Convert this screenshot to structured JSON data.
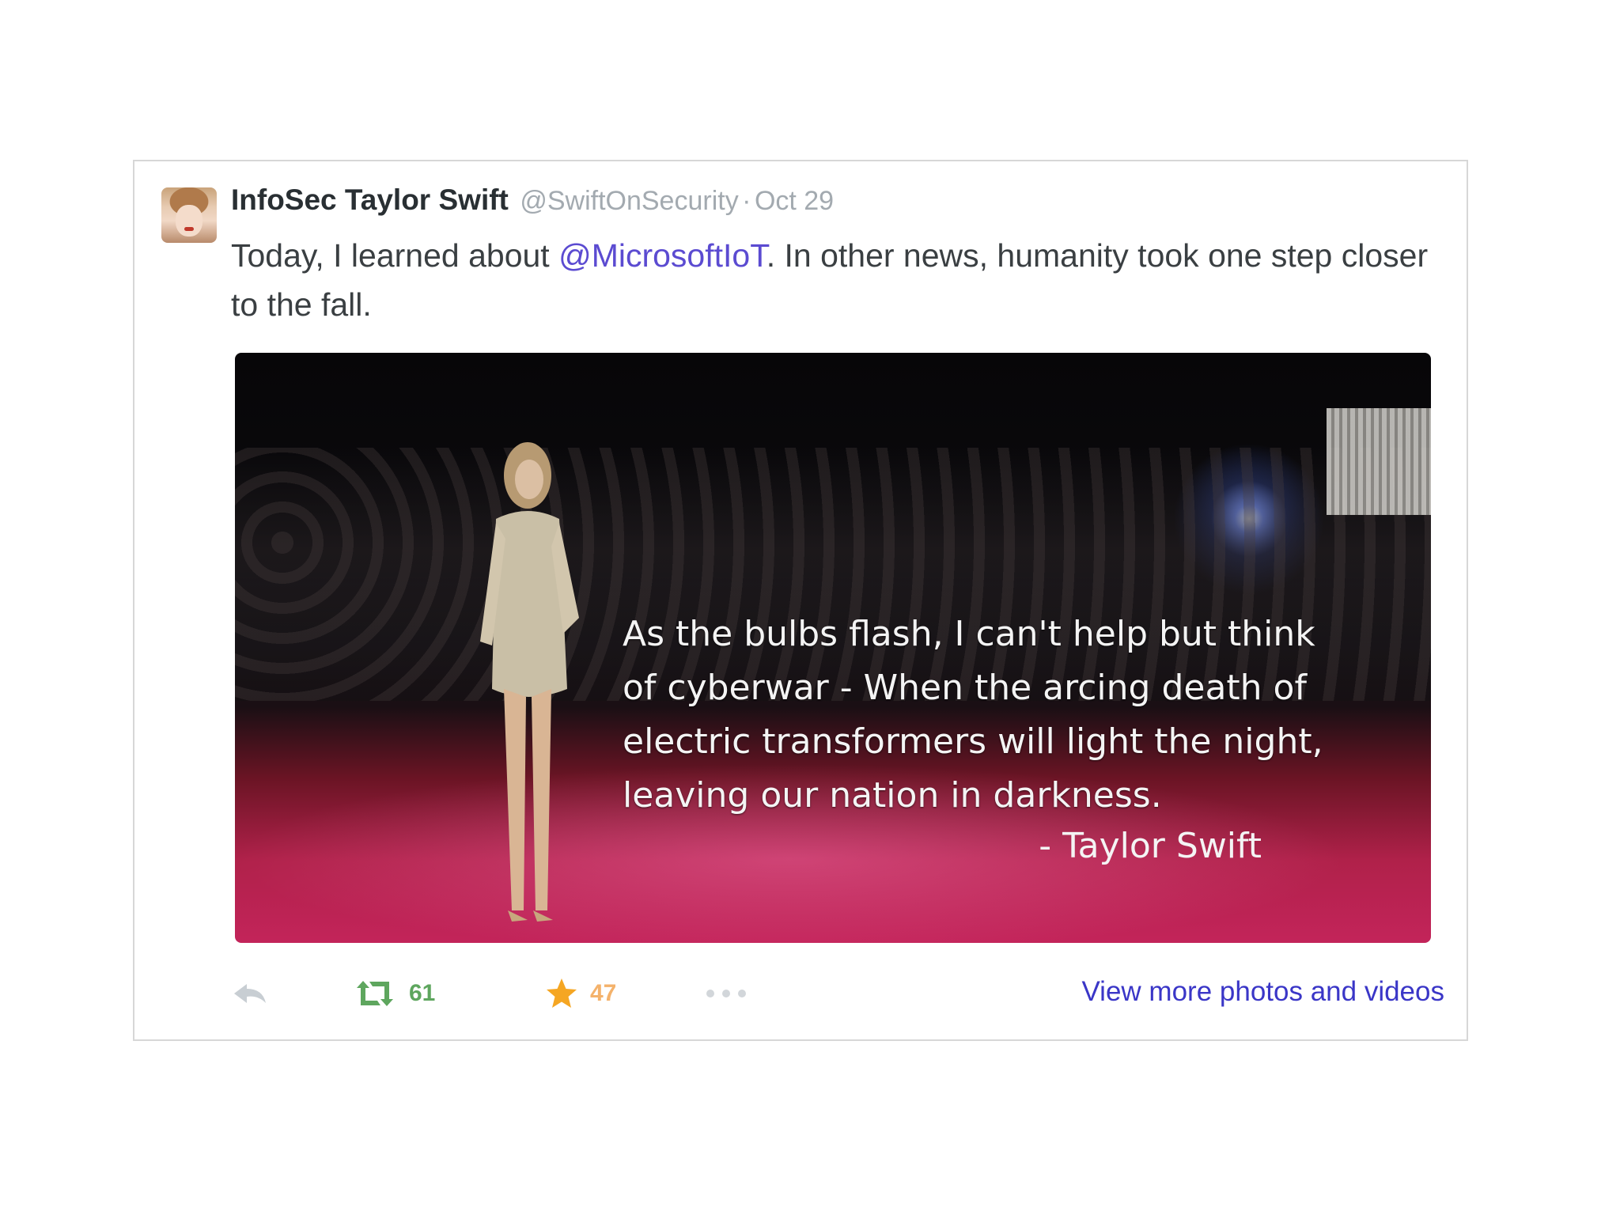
{
  "tweet": {
    "display_name": "InfoSec Taylor Swift",
    "handle": "@SwiftOnSecurity",
    "separator": "·",
    "date": "Oct 29",
    "text_before": "Today, I learned about ",
    "mention": "@MicrosoftIoT",
    "text_after": ". In other news, humanity took one step closer to the fall."
  },
  "photo": {
    "quote": "As the bulbs flash, I can't help but think of cyberwar - When the arcing death of electric transformers will light the night, leaving our nation in darkness.",
    "author": "- Taylor Swift"
  },
  "actions": {
    "retweet_count": "61",
    "favorite_count": "47",
    "view_more": "View more photos and videos"
  },
  "colors": {
    "mention": "#5b4bd1",
    "retweet": "#5ea65e",
    "favorite": "#f4b26b",
    "link": "#3a36c7"
  },
  "icons": [
    "reply-icon",
    "retweet-icon",
    "star-icon",
    "more-icon"
  ]
}
